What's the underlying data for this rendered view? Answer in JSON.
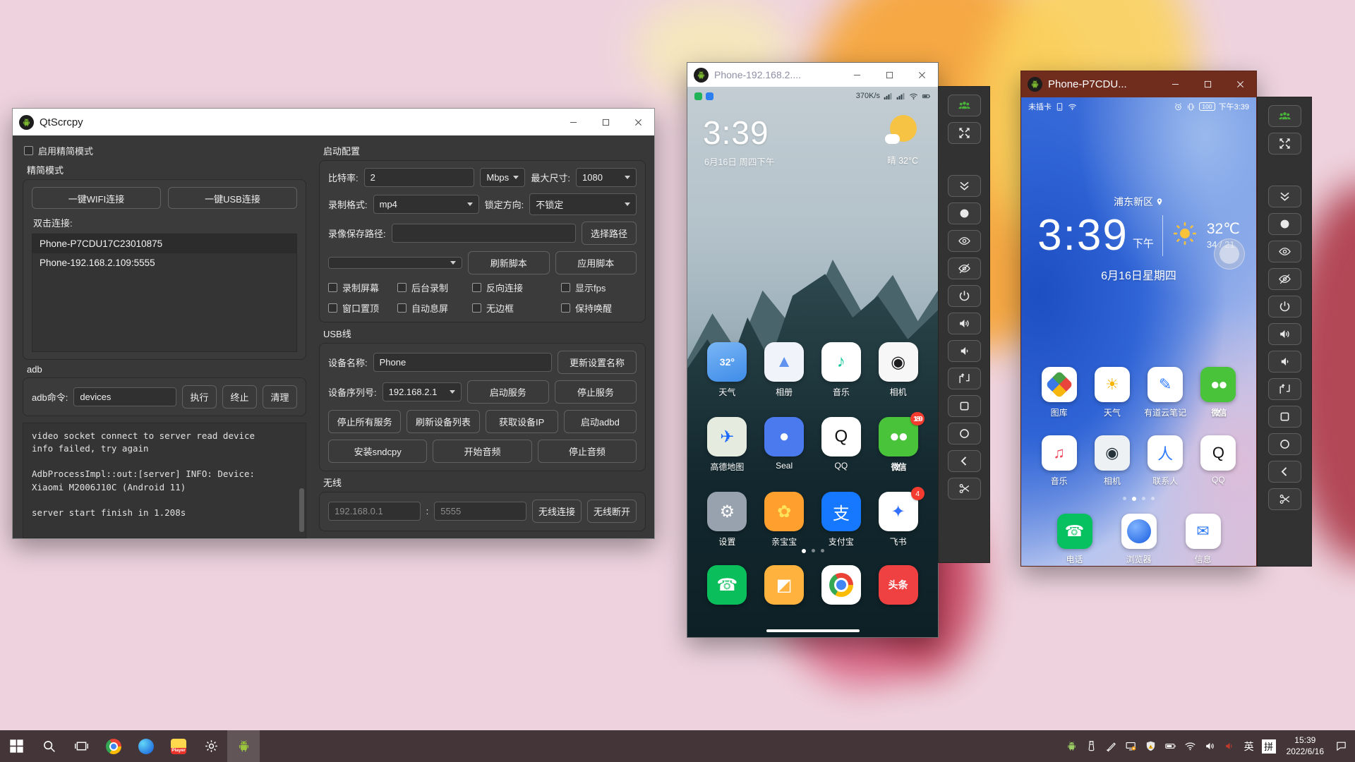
{
  "qtscrcpy": {
    "title": "QtScrcpy",
    "simple_mode_checkbox": "启用精简模式",
    "simple_group_title": "精简模式",
    "wifi_connect_button": "一键WIFI连接",
    "usb_connect_button": "一键USB连接",
    "double_click_label": "双击连接:",
    "device_list": [
      "Phone-P7CDU17C23010875",
      "Phone-192.168.2.109:5555"
    ],
    "adb_label": "adb",
    "adb_cmd_label": "adb命令:",
    "adb_cmd_value": "devices",
    "run_button": "执行",
    "stop_button": "终止",
    "clear_button": "清理",
    "log_text": "video socket connect to server read device\ninfo failed, try again\n\nAdbProcessImpl::out:[server] INFO: Device:\nXiaomi M2006J10C (Android 11)\n\nserver start finish in 1.208s",
    "config_title": "启动配置",
    "bitrate_label": "比特率:",
    "bitrate_value": "2",
    "bitrate_unit": "Mbps",
    "max_size_label": "最大尺寸:",
    "max_size_value": "1080",
    "format_label": "录制格式:",
    "format_value": "mp4",
    "lock_label": "锁定方向:",
    "lock_value": "不锁定",
    "path_label": "录像保存路径:",
    "path_value": "",
    "choose_path_button": "选择路径",
    "refresh_script_button": "刷新脚本",
    "apply_script_button": "应用脚本",
    "checkboxes": [
      {
        "label": "录制屏幕"
      },
      {
        "label": "后台录制"
      },
      {
        "label": "反向连接"
      },
      {
        "label": "显示fps"
      },
      {
        "label": "窗口置顶"
      },
      {
        "label": "自动息屏"
      },
      {
        "label": "无边框"
      },
      {
        "label": "保持唤醒"
      }
    ],
    "usb_title": "USB线",
    "device_name_label": "设备名称:",
    "device_name_value": "Phone",
    "update_name_button": "更新设置名称",
    "serial_label": "设备序列号:",
    "serial_value": "192.168.2.1",
    "start_service_button": "启动服务",
    "stop_service_button": "停止服务",
    "stop_all_button": "停止所有服务",
    "refresh_devices_button": "刷新设备列表",
    "get_ip_button": "获取设备IP",
    "start_adbd_button": "启动adbd",
    "install_sndcpy_button": "安装sndcpy",
    "start_audio_button": "开始音频",
    "stop_audio_button": "停止音频",
    "wireless_title": "无线",
    "wireless_ip_placeholder": "192.168.0.1",
    "wireless_sep": ":",
    "wireless_port_placeholder": "5555",
    "wireless_connect_button": "无线连接",
    "wireless_disconnect_button": "无线断开"
  },
  "phone1": {
    "window_title": "Phone-192.168.2....",
    "net_speed": "370K/s",
    "clock": "3:39",
    "date": "6月16日 周四下午",
    "weather": "晴 32°C",
    "apps": [
      {
        "label": "天气",
        "glyph": "32°",
        "bg": "linear-gradient(160deg,#7ab6f6,#3e8ce8)",
        "fg": "#ffffff",
        "cls": "smalltext"
      },
      {
        "label": "相册",
        "glyph": "▲",
        "bg": "#f0f4fa",
        "fg": "#5f93ef"
      },
      {
        "label": "音乐",
        "glyph": "♪",
        "bg": "#ffffff",
        "fg": "#14c79a"
      },
      {
        "label": "相机",
        "glyph": "◉",
        "bg": "#f7f7f7",
        "fg": "#1d1d1f"
      },
      {
        "label": "高德地图",
        "glyph": "✈",
        "bg": "#e5ecdf",
        "fg": "#1a66ff"
      },
      {
        "label": "Seal",
        "glyph": "●",
        "bg": "#4b79ee",
        "fg": "#ffffff"
      },
      {
        "label": "QQ",
        "glyph": "Q",
        "bg": "#ffffff",
        "fg": "#111111"
      },
      {
        "label": "微信",
        "glyph": "●●",
        "bg": "#48c33a",
        "fg": "#ffffff",
        "badge": "189",
        "cls": "wechat-g"
      },
      {
        "label": "设置",
        "glyph": "⚙",
        "bg": "#97a2ae",
        "fg": "#ffffff"
      },
      {
        "label": "亲宝宝",
        "glyph": "✿",
        "bg": "#ffa02e",
        "fg": "#ffe25c"
      },
      {
        "label": "支付宝",
        "glyph": "支",
        "bg": "#1677ff",
        "fg": "#ffffff"
      },
      {
        "label": "飞书",
        "glyph": "✦",
        "bg": "#ffffff",
        "fg": "#3370ff",
        "badge": "4"
      }
    ],
    "dock": [
      {
        "glyph": "☎",
        "bg": "#0abf5b",
        "fg": "#ffffff"
      },
      {
        "glyph": "◩",
        "bg": "#ffb23e",
        "fg": "#ffffff"
      },
      {
        "glyph": "",
        "bg": "#ffffff",
        "cls": "chromeapp"
      },
      {
        "glyph": "头条",
        "bg": "#f04142",
        "fg": "#ffffff",
        "cls": "smalltext"
      }
    ],
    "dots": [
      {
        "cls": "on"
      },
      {},
      {}
    ]
  },
  "phone2": {
    "window_title": "Phone-P7CDU...",
    "status_left": "未插卡",
    "battery": "100",
    "status_time": "下午3:39",
    "location": "浦东新区",
    "clock": "3:39",
    "ampm": "下午",
    "temp": "32℃",
    "temp_range": "34 / 21",
    "date": "6月16日星期四",
    "apps": [
      {
        "label": "图库",
        "glyph": "",
        "bg": "#ffffff",
        "cls": "galleryapp"
      },
      {
        "label": "天气",
        "glyph": "☀",
        "bg": "#ffffff",
        "fg": "#f7b500"
      },
      {
        "label": "有道云笔记",
        "glyph": "✎",
        "bg": "#ffffff",
        "fg": "#2e7bff"
      },
      {
        "label": "微信",
        "glyph": "●●",
        "bg": "#48c33a",
        "fg": "#ffffff",
        "cls": "wechat-g"
      },
      {
        "label": "音乐",
        "glyph": "♫",
        "bg": "#ffffff",
        "fg": "#ef4458"
      },
      {
        "label": "相机",
        "glyph": "◉",
        "bg": "#eef1f4",
        "fg": "#26323a"
      },
      {
        "label": "联系人",
        "glyph": "人",
        "bg": "#ffffff",
        "fg": "#2e7bff"
      },
      {
        "label": "QQ",
        "glyph": "Q",
        "bg": "#ffffff",
        "fg": "#111111"
      }
    ],
    "dock": [
      {
        "label": "电话",
        "glyph": "☎",
        "bg": "#07c160",
        "fg": "#ffffff"
      },
      {
        "label": "浏览器",
        "glyph": "",
        "bg": "#ffffff",
        "cls": "browserapp"
      },
      {
        "label": "信息",
        "glyph": "✉",
        "bg": "#ffffff",
        "fg": "#2f7cf6"
      }
    ],
    "dots": [
      {},
      {
        "cls": "on"
      },
      {},
      {}
    ]
  },
  "toolbar": {
    "buttons": [
      {
        "icon": "group",
        "name": "group-control-button",
        "color": "#49b23b"
      },
      {
        "icon": "fullscreen",
        "name": "fullscreen-button"
      },
      {
        "icon": "chevrons",
        "name": "expand-toolbar-button",
        "cls": "gap"
      },
      {
        "icon": "record",
        "name": "touch-indicator-button"
      },
      {
        "icon": "eye",
        "name": "screen-on-button"
      },
      {
        "icon": "eyeoff",
        "name": "screen-off-button"
      },
      {
        "icon": "power",
        "name": "power-button"
      },
      {
        "icon": "volup",
        "name": "volume-up-button"
      },
      {
        "icon": "voldown",
        "name": "volume-down-button"
      },
      {
        "icon": "switch",
        "name": "rotate-screen-button"
      },
      {
        "icon": "square",
        "name": "menu-button"
      },
      {
        "icon": "circleO",
        "name": "home-button"
      },
      {
        "icon": "back",
        "name": "back-button"
      },
      {
        "icon": "scissors",
        "name": "screenshot-button"
      }
    ]
  },
  "taskbar": {
    "items": [
      {
        "icon": "windows",
        "name": "start-button"
      },
      {
        "icon": "search",
        "name": "search-button"
      },
      {
        "icon": "taskview",
        "name": "task-view-button"
      },
      {
        "name": "chrome-icon",
        "cls": "chromeball"
      },
      {
        "name": "blue-app-icon",
        "cls": "blueapp"
      },
      {
        "name": "player-app-icon",
        "cls": "playerapp",
        "glyph": "Player"
      },
      {
        "icon": "gear",
        "name": "settings-icon"
      },
      {
        "icon": "android",
        "name": "qtscrcpy-taskbar-icon",
        "color": "#9bc53d",
        "cls": "active"
      }
    ],
    "tray": [
      {
        "icon": "android",
        "name": "android-tray-icon",
        "color": "#9ccc65"
      },
      {
        "icon": "usb",
        "name": "usb-tray-icon"
      },
      {
        "icon": "brush",
        "name": "pen-tray-icon"
      },
      {
        "icon": "sync",
        "name": "cast-tray-icon"
      },
      {
        "icon": "shield",
        "name": "security-tray-icon"
      },
      {
        "icon": "battery",
        "name": "battery-tray-icon"
      },
      {
        "icon": "wifi",
        "name": "wifi-tray-icon"
      },
      {
        "icon": "volume",
        "name": "volume-tray-icon"
      },
      {
        "icon": "volumered",
        "name": "red-volume-tray-icon",
        "color": "#c0392b"
      }
    ],
    "lang": "英",
    "ime": "拼",
    "time": "15:39",
    "date": "2022/6/16"
  }
}
